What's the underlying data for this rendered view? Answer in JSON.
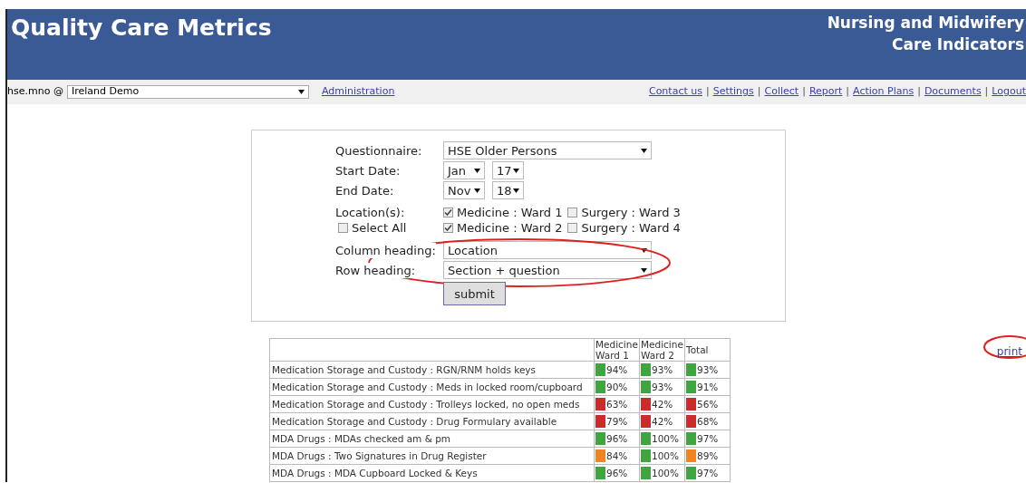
{
  "header": {
    "title": "Quality Care Metrics",
    "subtitle_lines": [
      "Nursing and Midwifery",
      "Care Indicators"
    ]
  },
  "top_bar": {
    "user": "hse.mno @",
    "organisation": "Ireland Demo",
    "admin_link": "Administration",
    "links": [
      "Contact us",
      "Settings",
      "Collect",
      "Report",
      "Action Plans",
      "Documents",
      "Logout"
    ],
    "separator": "|"
  },
  "form": {
    "questionnaire": {
      "label": "Questionnaire:",
      "value": "HSE Older Persons"
    },
    "start_date": {
      "label": "Start Date:",
      "month": "Jan",
      "year": "17"
    },
    "end_date": {
      "label": "End Date:",
      "month": "Nov",
      "year": "18"
    },
    "locations": {
      "label": "Location(s):",
      "select_all": {
        "label": "Select All",
        "checked": false
      },
      "options": [
        {
          "label": "Medicine : Ward 1",
          "checked": true
        },
        {
          "label": "Surgery : Ward 3",
          "checked": false
        },
        {
          "label": "Medicine : Ward 2",
          "checked": true
        },
        {
          "label": "Surgery : Ward 4",
          "checked": false
        }
      ]
    },
    "column_heading": {
      "label": "Column heading:",
      "value": "Location"
    },
    "row_heading": {
      "label": "Row heading:",
      "value": "Section + question"
    },
    "submit": "submit"
  },
  "print_link": "print",
  "table": {
    "columns": [
      "Medicine Ward 1",
      "Medicine Ward 2",
      "Total"
    ],
    "rows": [
      {
        "label": "Medication Storage and Custody : RGN/RNM holds keys",
        "cells": [
          {
            "value": "94%",
            "color": "#3fa63f"
          },
          {
            "value": "93%",
            "color": "#3fa63f"
          },
          {
            "value": "93%",
            "color": "#3fa63f"
          }
        ]
      },
      {
        "label": "Medication Storage and Custody : Meds in locked room/cupboard",
        "cells": [
          {
            "value": "90%",
            "color": "#3fa63f"
          },
          {
            "value": "93%",
            "color": "#3fa63f"
          },
          {
            "value": "91%",
            "color": "#3fa63f"
          }
        ]
      },
      {
        "label": "Medication Storage and Custody : Trolleys locked, no open meds",
        "cells": [
          {
            "value": "63%",
            "color": "#cc2b2b"
          },
          {
            "value": "42%",
            "color": "#cc2b2b"
          },
          {
            "value": "56%",
            "color": "#cc2b2b"
          }
        ]
      },
      {
        "label": "Medication Storage and Custody : Drug Formulary available",
        "cells": [
          {
            "value": "79%",
            "color": "#cc2b2b"
          },
          {
            "value": "42%",
            "color": "#cc2b2b"
          },
          {
            "value": "68%",
            "color": "#cc2b2b"
          }
        ]
      },
      {
        "label": "MDA Drugs : MDAs checked am & pm",
        "cells": [
          {
            "value": "96%",
            "color": "#3fa63f"
          },
          {
            "value": "100%",
            "color": "#3fa63f"
          },
          {
            "value": "97%",
            "color": "#3fa63f"
          }
        ]
      },
      {
        "label": "MDA Drugs : Two Signatures in Drug Register",
        "cells": [
          {
            "value": "84%",
            "color": "#f08422"
          },
          {
            "value": "100%",
            "color": "#3fa63f"
          },
          {
            "value": "89%",
            "color": "#f08422"
          }
        ]
      },
      {
        "label": "MDA Drugs : MDA Cupboard Locked & Keys",
        "cells": [
          {
            "value": "96%",
            "color": "#3fa63f"
          },
          {
            "value": "100%",
            "color": "#3fa63f"
          },
          {
            "value": "97%",
            "color": "#3fa63f"
          }
        ]
      }
    ]
  }
}
